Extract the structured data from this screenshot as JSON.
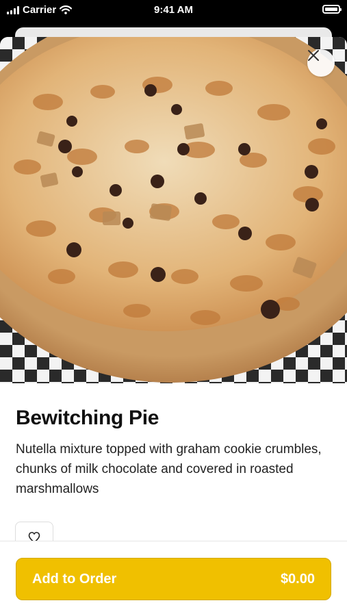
{
  "status_bar": {
    "carrier": "Carrier",
    "time": "9:41 AM",
    "icons": [
      "signal-icon",
      "wifi-icon",
      "battery-icon"
    ]
  },
  "hero": {
    "image": "pizza-photo",
    "close_icon": "close-icon"
  },
  "item": {
    "title": "Bewitching Pie",
    "description": "Nutella mixture topped with graham cookie crumbles, chunks of milk chocolate and covered in roasted marshmallows"
  },
  "favorite": {
    "icon": "heart-icon"
  },
  "footer": {
    "add_label": "Add to Order",
    "price": "$0.00"
  },
  "colors": {
    "accent": "#f0c000",
    "text": "#111111"
  }
}
